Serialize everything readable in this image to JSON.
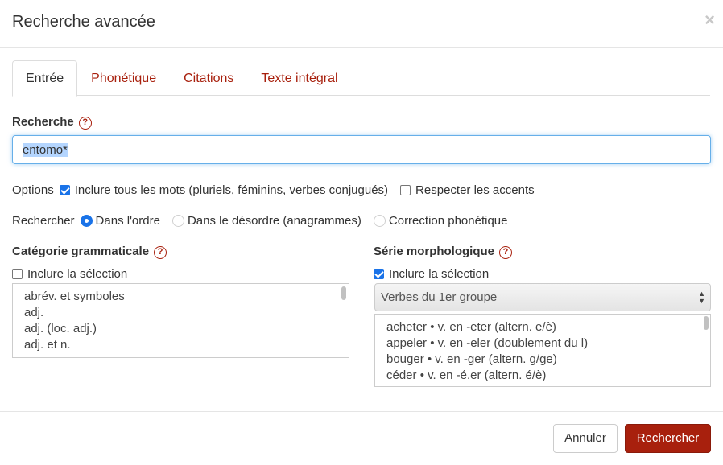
{
  "dialog": {
    "title": "Recherche avancée",
    "close_glyph": "×"
  },
  "tabs": [
    {
      "label": "Entrée",
      "active": true
    },
    {
      "label": "Phonétique",
      "active": false
    },
    {
      "label": "Citations",
      "active": false
    },
    {
      "label": "Texte intégral",
      "active": false
    }
  ],
  "search": {
    "label": "Recherche",
    "help_glyph": "?",
    "value": "entomo*"
  },
  "options": {
    "label": "Options",
    "include_all_words": {
      "label": "Inclure tous les mots (pluriels, féminins, verbes conjugués)",
      "checked": true
    },
    "respect_accents": {
      "label": "Respecter les accents",
      "checked": false
    }
  },
  "search_mode": {
    "label": "Rechercher",
    "choices": [
      {
        "label": "Dans l'ordre",
        "selected": true
      },
      {
        "label": "Dans le désordre (anagrammes)",
        "selected": false
      },
      {
        "label": "Correction phonétique",
        "selected": false
      }
    ]
  },
  "grammatical_category": {
    "label": "Catégorie grammaticale",
    "help_glyph": "?",
    "include_selection": {
      "label": "Inclure la sélection",
      "checked": false
    },
    "items": [
      "abrév. et symboles",
      "adj.",
      "adj. (loc. adj.)",
      "adj. et n."
    ]
  },
  "morphological_series": {
    "label": "Série morphologique",
    "help_glyph": "?",
    "include_selection": {
      "label": "Inclure la sélection",
      "checked": true
    },
    "selected_group": "Verbes du 1er groupe",
    "items": [
      "acheter • v. en -eter (altern. e/è)",
      "appeler • v. en -eler (doublement du l)",
      "bouger • v. en -ger (altern. g/ge)",
      "céder • v. en -é.er (altern. é/è)"
    ]
  },
  "footer": {
    "cancel_label": "Annuler",
    "submit_label": "Rechercher"
  },
  "colors": {
    "accent": "#a8200d",
    "focus": "#66afe9",
    "checkbox": "#1a73e8"
  }
}
